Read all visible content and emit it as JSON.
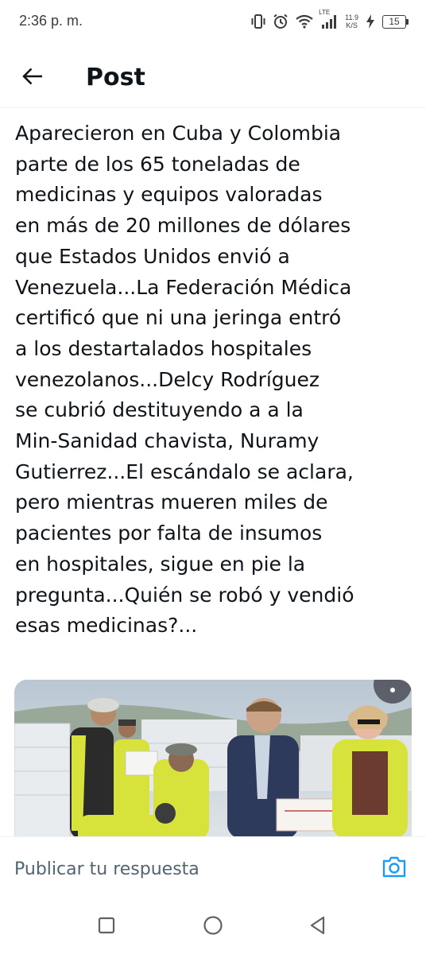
{
  "status_bar": {
    "time": "2:36 p. m.",
    "net_speed_value": "11.9",
    "net_speed_unit": "K/S",
    "network_type": "LTE",
    "battery_level": "15",
    "icons": [
      "vibrate-icon",
      "alarm-icon",
      "wifi-icon",
      "signal-icon",
      "charging-icon",
      "battery-icon"
    ]
  },
  "header": {
    "title": "Post",
    "back_icon": "arrow-left-icon"
  },
  "tweet": {
    "text_lines": [
      "Aparecieron en Cuba y Colombia",
      "parte de los 65 toneladas de",
      "medicinas y equipos valoradas",
      "en más de 20 millones de dólares",
      "que Estados Unidos envió a",
      "Venezuela...La Federación Médica",
      "certificó que ni una jeringa entró",
      "a los destartalados hospitales",
      "venezolanos...Delcy Rodríguez",
      "se cubrió destituyendo a a la",
      "Min-Sanidad chavista, Nuramy",
      "Gutierrez...El escándalo se aclara,",
      "pero mientras mueren miles de",
      "pacientes por falta de insumos",
      "en hospitales, sigue en pie la",
      "pregunta...Quién se robó y vendió",
      "esas medicinas?..."
    ]
  },
  "reply": {
    "placeholder": "Publicar tu respuesta",
    "camera_icon": "camera-icon"
  },
  "nav": {
    "icons": [
      "recents-square-icon",
      "home-circle-icon",
      "back-triangle-icon"
    ]
  },
  "colors": {
    "text": "#0f1419",
    "secondary_text": "#536471",
    "accent": "#1d9bf0",
    "divider": "#eff3f4",
    "safety_vest": "#d7e33a"
  }
}
